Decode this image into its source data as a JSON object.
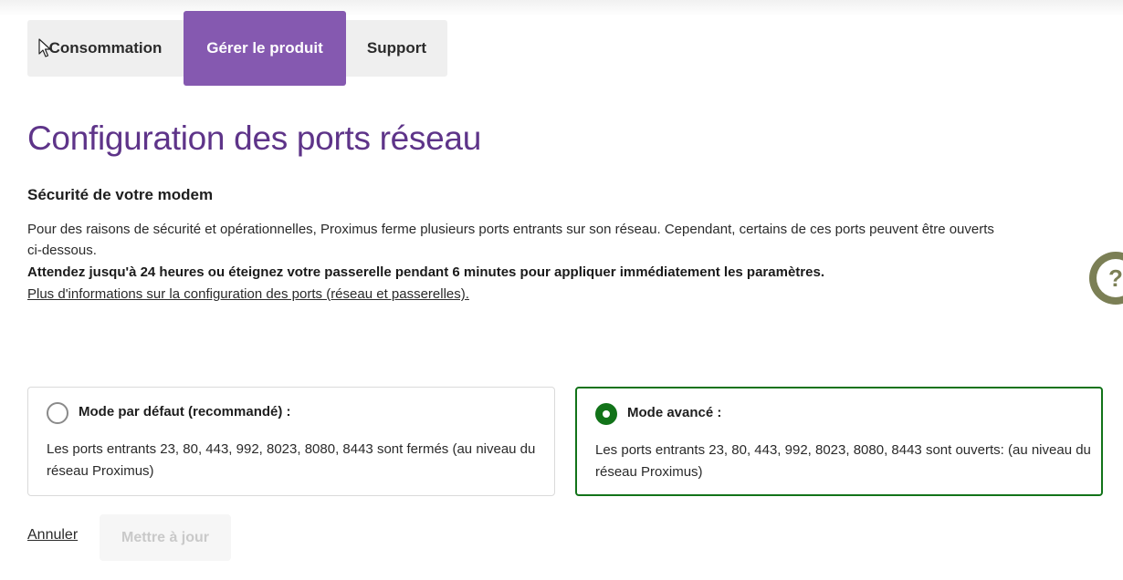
{
  "colors": {
    "accent": "#8559b0",
    "title": "#5e3489",
    "success": "#127319"
  },
  "tabs": [
    {
      "label": "Consommation",
      "active": false
    },
    {
      "label": "Gérer le produit",
      "active": true
    },
    {
      "label": "Support",
      "active": false
    }
  ],
  "page_title": "Configuration des ports réseau",
  "section_title": "Sécurité de votre modem",
  "description": {
    "line1": "Pour des raisons de sécurité et opérationnelles, Proximus ferme plusieurs ports entrants sur son réseau. Cependant, certains de ces ports peuvent être ouverts",
    "line2": "ci-dessous.",
    "warning": "Attendez jusqu'à 24 heures ou éteignez votre passerelle pendant 6 minutes pour appliquer immédiatement les paramètres.",
    "link": "Plus d'informations sur la configuration des ports (réseau et passerelles)."
  },
  "help_icon": "question-mark",
  "options": {
    "default": {
      "label": "Mode par défaut (recommandé) :",
      "description": "Les ports entrants 23, 80, 443, 992, 8023, 8080, 8443 sont fermés (au niveau du réseau Proximus)",
      "selected": false
    },
    "advanced": {
      "label": "Mode avancé :",
      "description": "Les ports entrants 23, 80, 443, 992, 8023, 8080, 8443 sont ouverts: (au niveau du réseau Proximus)",
      "selected": true
    }
  },
  "actions": {
    "cancel_label": "Annuler",
    "update_label": "Mettre à jour"
  }
}
